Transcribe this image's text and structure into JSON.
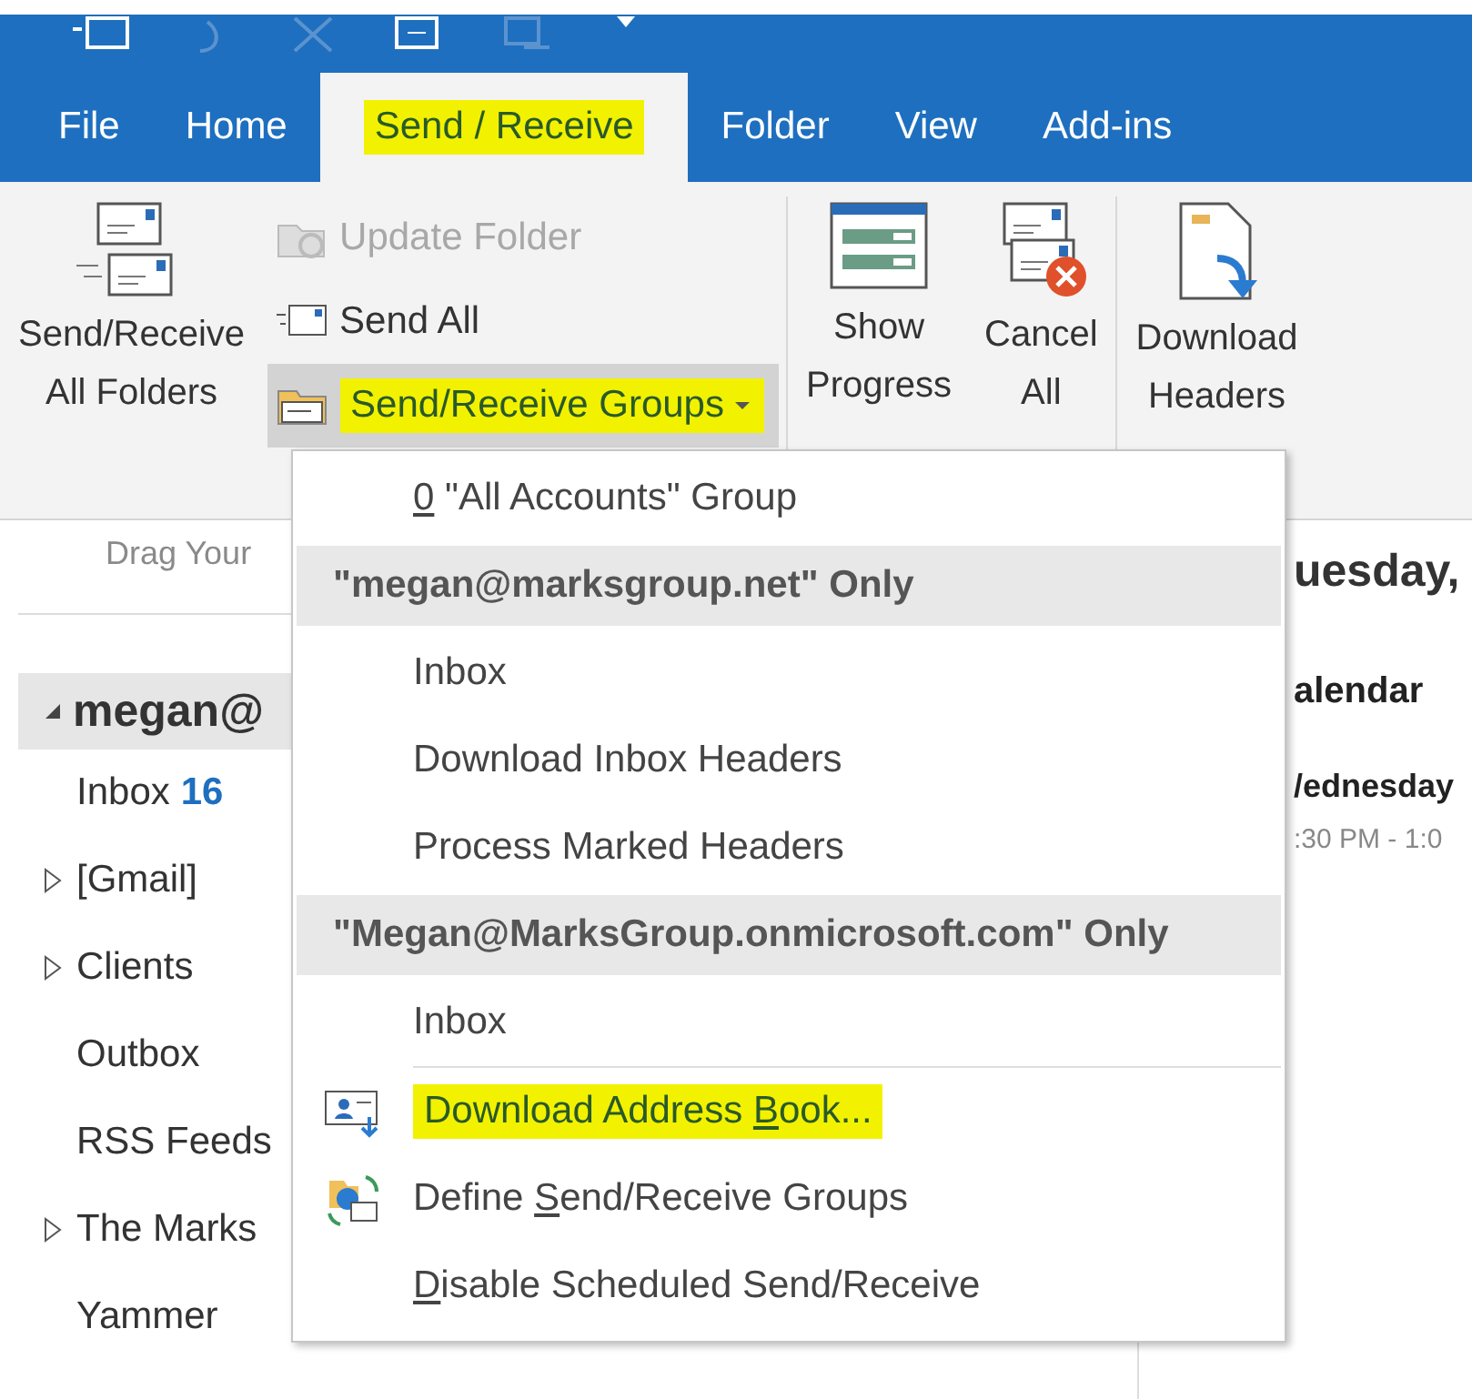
{
  "tabs": [
    {
      "label": "File",
      "selected": false,
      "highlighted": false
    },
    {
      "label": "Home",
      "selected": false,
      "highlighted": false
    },
    {
      "label": "Send / Receive",
      "selected": true,
      "highlighted": true
    },
    {
      "label": "Folder",
      "selected": false,
      "highlighted": false
    },
    {
      "label": "View",
      "selected": false,
      "highlighted": false
    },
    {
      "label": "Add-ins",
      "selected": false,
      "highlighted": false
    }
  ],
  "ribbon": {
    "send_receive_all": {
      "line1": "Send/Receive",
      "line2": "All Folders"
    },
    "small_buttons": [
      {
        "kind": "update",
        "label": "Update Folder",
        "disabled": true,
        "highlighted": false,
        "dropdown": false
      },
      {
        "kind": "send",
        "label": "Send All",
        "disabled": false,
        "highlighted": false,
        "dropdown": false
      },
      {
        "kind": "groups",
        "label": "Send/Receive Groups",
        "disabled": false,
        "highlighted": true,
        "dropdown": true
      }
    ],
    "progress_buttons": [
      {
        "kind": "progress",
        "line1": "Show",
        "line2": "Progress"
      },
      {
        "kind": "cancel",
        "line1": "Cancel",
        "line2": "All"
      },
      {
        "kind": "download",
        "line1": "Download",
        "line2": "Headers"
      }
    ]
  },
  "folder_pane": {
    "hint": "Drag Your",
    "account": "megan@",
    "folders": [
      {
        "name": "Inbox",
        "count": "16",
        "expandable": false
      },
      {
        "name": "[Gmail]",
        "expandable": true
      },
      {
        "name": "Clients",
        "expandable": true
      },
      {
        "name": "Outbox",
        "expandable": false
      },
      {
        "name": "RSS Feeds",
        "expandable": false
      },
      {
        "name": "The Marks",
        "expandable": true
      },
      {
        "name": "Yammer",
        "expandable": false
      }
    ]
  },
  "calendar_peek": {
    "day": "uesday,",
    "title": "alendar",
    "date": "/ednesday",
    "time": ":30 PM - 1:0"
  },
  "menu": {
    "items": [
      {
        "kind": "item",
        "key": "0",
        "post": " \"All Accounts\" Group",
        "highlighted": false
      },
      {
        "kind": "header",
        "label": "\"megan@marksgroup.net\" Only"
      },
      {
        "kind": "item",
        "pre": "Inbox",
        "highlighted": false
      },
      {
        "kind": "item",
        "pre": "Download Inbox Headers",
        "highlighted": false
      },
      {
        "kind": "item",
        "pre": "Process Marked Headers",
        "highlighted": false
      },
      {
        "kind": "header",
        "label": "\"Megan@MarksGroup.onmicrosoft.com\" Only"
      },
      {
        "kind": "item",
        "pre": "Inbox",
        "highlighted": false
      },
      {
        "kind": "separator"
      },
      {
        "kind": "addressbook",
        "pre": "Download Address ",
        "key": "B",
        "post": "ook...",
        "highlighted": true
      },
      {
        "kind": "define",
        "pre": "Define ",
        "key": "S",
        "post": "end/Receive Groups",
        "highlighted": false
      },
      {
        "kind": "item",
        "key": "D",
        "post": "isable Scheduled Send/Receive",
        "highlighted": false
      }
    ]
  }
}
